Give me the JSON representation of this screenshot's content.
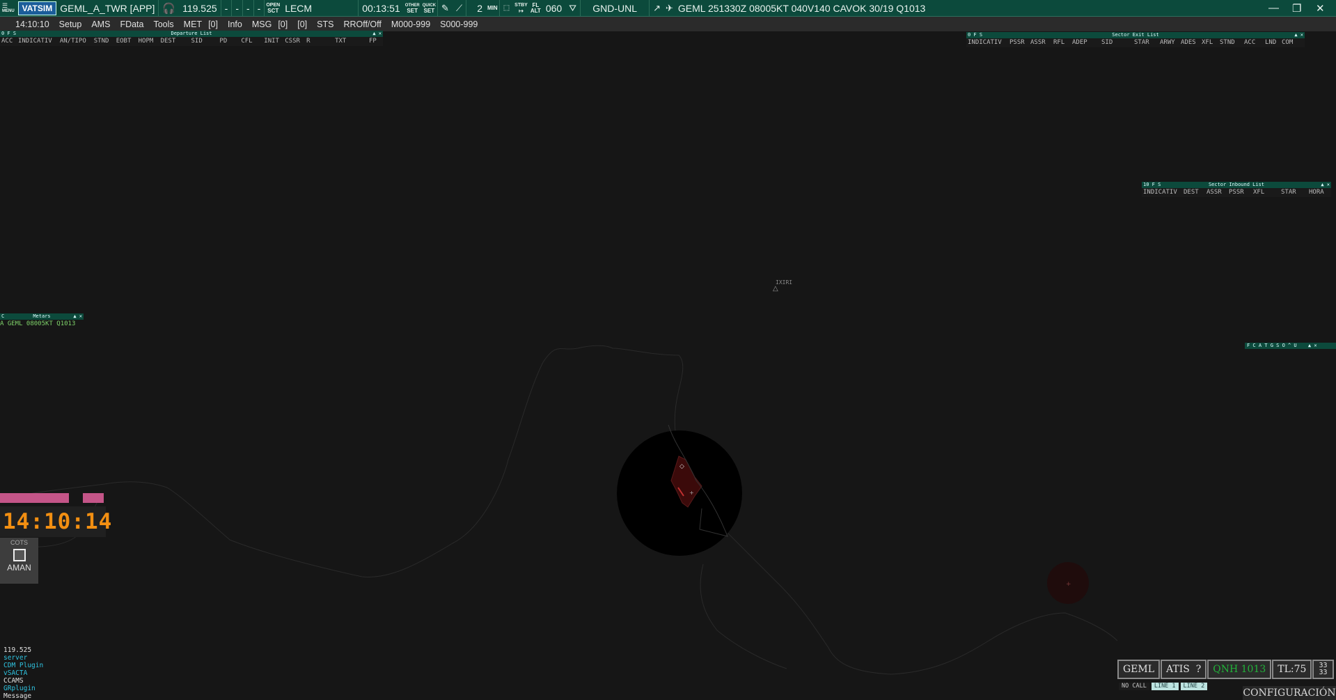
{
  "topbar": {
    "menu_label": "MENU",
    "logo": "VATSIM",
    "callsign": "GEML_A_TWR [APP]",
    "frequency": "119.525",
    "dash1": "-",
    "dash2": "-",
    "dash3": "-",
    "dash4": "-",
    "open_top": "OPEN",
    "open_bottom": "SCT",
    "sector": "LECM",
    "timer": "00:13:51",
    "other_top": "OTHER",
    "other_bottom": "SET",
    "quick_top": "QUICK",
    "quick_bottom": "SET",
    "count": "2",
    "min_label": "MIN",
    "stby_top": "STBY",
    "stby_bottom": "↦",
    "fl_top": "FL",
    "fl_bottom": "ALT",
    "level": "060",
    "range": "GND-UNL",
    "metar": "GEML 251330Z 08005KT 040V140 CAVOK 30/19 Q1013",
    "icons": [
      "headset-icon",
      "pencil-icon",
      "ruler-icon",
      "filter-icon",
      "wind-icon",
      "plane-icon"
    ]
  },
  "menubar": {
    "time": "14:10:10",
    "items": [
      "Setup",
      "AMS",
      "FData",
      "Tools",
      "MET",
      "[0]",
      "Info",
      "MSG",
      "[0]",
      "[0]",
      "STS",
      "RROff/Off",
      "M000-999",
      "S000-999"
    ]
  },
  "departure_list": {
    "flags": "0  F  S",
    "title": "Departure List",
    "columns": [
      "ACC",
      "INDICATIV",
      "AN/TIPO",
      "STND",
      "EOBT",
      "HOPM",
      "DEST",
      "SID",
      "PD",
      "CFL",
      "INIT",
      "CSSR",
      "R",
      "TXT",
      "FP"
    ]
  },
  "sector_exit_list": {
    "flags": "0  F  S",
    "title": "Sector Exit List",
    "columns": [
      "INDICATIV",
      "PSSR",
      "ASSR",
      "RFL",
      "ADEP",
      "SID",
      "STAR",
      "ARWY",
      "ADES",
      "XFL",
      "STND",
      "ACC",
      "LND",
      "COM"
    ]
  },
  "sector_inbound_list": {
    "flags": "10  F  S",
    "title": "Sector Inbound List",
    "columns": [
      "INDICATIV",
      "DEST",
      "ASSR",
      "PSSR",
      "XFL",
      "STAR",
      "HORA"
    ]
  },
  "metars": {
    "flag": "C",
    "title": "Metars",
    "line": "A GEML 08005KT Q1013"
  },
  "toolbar_right": {
    "label": "F C A T G S O ^ U"
  },
  "map": {
    "waypoint": "IXIRI"
  },
  "clock": {
    "time": "14:10:14",
    "cots_label": "COTS",
    "aman_label": "AMAN"
  },
  "messages": [
    {
      "text": "119.525",
      "color": "#e0e0e0"
    },
    {
      "text": "server",
      "color": "#2fc3e0"
    },
    {
      "text": "CDM Plugin",
      "color": "#2fc3e0"
    },
    {
      "text": "vSACTA",
      "color": "#2fc3e0"
    },
    {
      "text": "CCAMS",
      "color": "#e0e0e0"
    },
    {
      "text": "GRplugin",
      "color": "#2fc3e0"
    },
    {
      "text": "Message",
      "color": "#e0e0e0"
    }
  ],
  "status": {
    "airport": "GEML",
    "atis": "ATIS  ?",
    "qnh": "QNH 1013",
    "tl": "TL:75",
    "wind_top": "33",
    "wind_bottom": "33",
    "no_call": "NO CALL",
    "line1": "LINE 1",
    "line2": "LINE 2",
    "config": "CONFIGURACIÓN"
  },
  "colors": {
    "bar": "#0c4a3c",
    "clock": "#f28f12",
    "qnh": "#22b33a",
    "message_cyan": "#2fc3e0",
    "pink_bar": "#c45588"
  }
}
